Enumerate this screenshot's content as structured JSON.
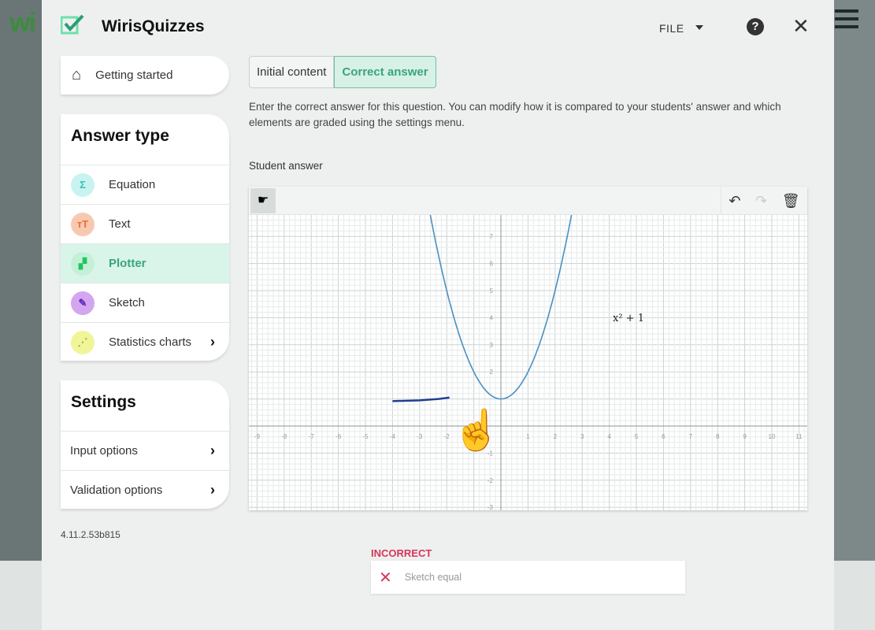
{
  "background": {
    "logo_text": "wi"
  },
  "header": {
    "title": "WirisQuizzes",
    "file_menu": "FILE",
    "help_icon": "help-icon",
    "close_icon": "close-icon"
  },
  "sidebar": {
    "getting_started": "Getting started",
    "answer_type": {
      "title": "Answer type",
      "items": [
        {
          "label": "Equation",
          "icon": "Σ",
          "color": "#c8f3f1",
          "fg": "#39c2b8"
        },
        {
          "label": "Text",
          "icon": "тT",
          "color": "#f8c9b1",
          "fg": "#ee6d33"
        },
        {
          "label": "Plotter",
          "icon": "▞",
          "color": "#c5f0d8",
          "fg": "#22c55e",
          "active": true
        },
        {
          "label": "Sketch",
          "icon": "✎",
          "color": "#d3a6ef",
          "fg": "#5b2bb5"
        },
        {
          "label": "Statistics charts",
          "icon": "⋰",
          "color": "#f0f59a",
          "fg": "#a8a820",
          "chevron": true
        }
      ]
    },
    "settings": {
      "title": "Settings",
      "items": [
        {
          "label": "Input options"
        },
        {
          "label": "Validation options"
        }
      ]
    },
    "version": "4.11.2.53b815"
  },
  "tabs": [
    {
      "label": "Initial content"
    },
    {
      "label": "Correct answer",
      "active": true
    }
  ],
  "description": "Enter the correct answer for this question. You can modify how it is compared to your students' answer and which elements are graded using the settings menu.",
  "student_answer_label": "Student answer",
  "plot": {
    "function_label": "x² + 1",
    "x_ticks": [
      -9,
      -8,
      -7,
      -6,
      -5,
      -4,
      -3,
      -2,
      1,
      2,
      3,
      4,
      5,
      6,
      7,
      8,
      9,
      10,
      11
    ],
    "y_ticks": [
      -3,
      -2,
      -1,
      2,
      3,
      4,
      5,
      6,
      7
    ],
    "curve_color": "#4a90c0",
    "sketch_color": "#1f3f8f",
    "sketch_points": [
      [
        -4,
        0.92
      ],
      [
        -3,
        0.95
      ],
      [
        -2.3,
        1.0
      ],
      [
        -1.9,
        1.05
      ]
    ]
  },
  "result": {
    "status": "INCORRECT",
    "item": "Sketch equal",
    "status_color": "#d6355a"
  }
}
